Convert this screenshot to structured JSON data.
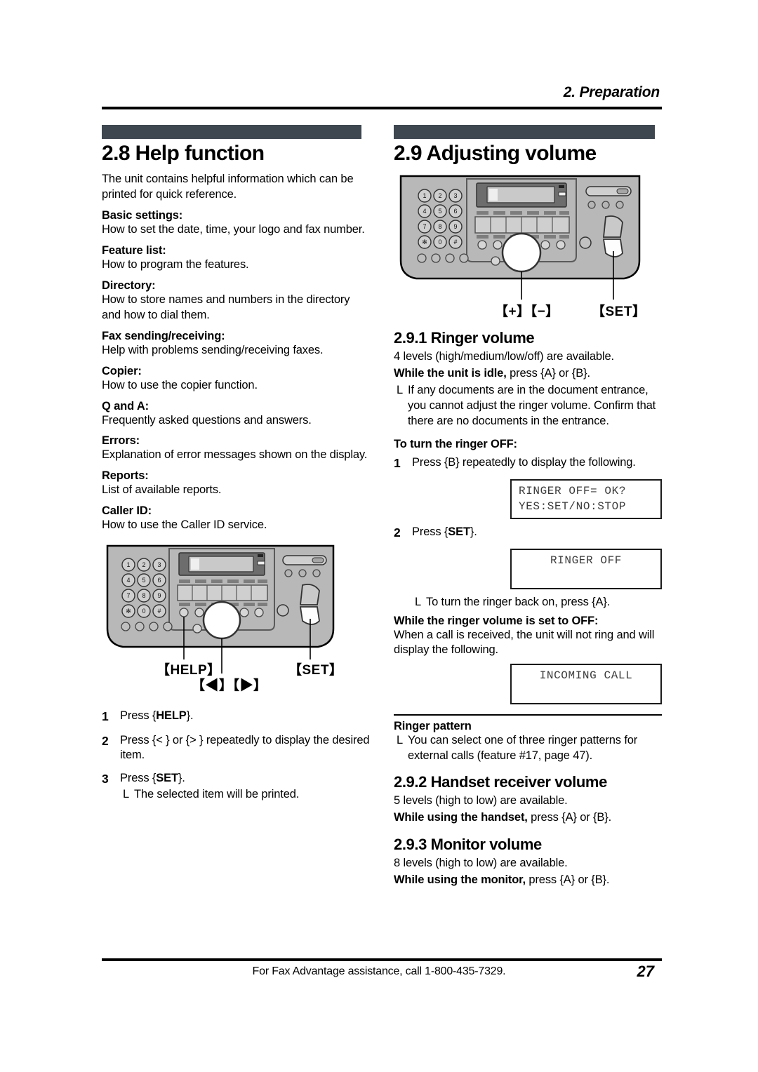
{
  "header": {
    "chapter": "2. Preparation"
  },
  "left_column": {
    "section_number_title": "2.8 Help function",
    "intro": "The unit contains helpful information which can be printed for quick reference.",
    "items": [
      {
        "term": "Basic settings:",
        "def": "How to set the date, time, your logo and fax number."
      },
      {
        "term": "Feature list:",
        "def": "How to program the features."
      },
      {
        "term": "Directory:",
        "def": "How to store names and numbers in the directory and how to dial them."
      },
      {
        "term": "Fax sending/receiving:",
        "def": "Help with problems sending/receiving faxes."
      },
      {
        "term": "Copier:",
        "def": "How to use the copier function."
      },
      {
        "term": "Q and A:",
        "def": "Frequently asked questions and answers."
      },
      {
        "term": "Errors:",
        "def": "Explanation of error messages shown on the display."
      },
      {
        "term": "Reports:",
        "def": "List of available reports."
      },
      {
        "term": "Caller ID:",
        "def": "How to use the Caller ID service."
      }
    ],
    "diagram": {
      "label_help": "【HELP】",
      "label_set": "【SET】",
      "label_arrows": "【◀】【▶】",
      "keypad": [
        "1",
        "2",
        "3",
        "4",
        "5",
        "6",
        "7",
        "8",
        "9",
        "✱",
        "0",
        "#"
      ]
    },
    "steps": [
      {
        "num": "1",
        "text": "Press {HELP}.",
        "bold_token": "HELP"
      },
      {
        "num": "2",
        "text": "Press {< } or {> } repeatedly to display the desired item."
      },
      {
        "num": "3",
        "text": "Press {SET}.",
        "bold_token": "SET",
        "sub": "The selected item will be printed."
      }
    ]
  },
  "right_column": {
    "section_number_title": "2.9 Adjusting volume",
    "diagram": {
      "label_plusminus": "【+】【−】",
      "label_set": "【SET】",
      "keypad": [
        "1",
        "2",
        "3",
        "4",
        "5",
        "6",
        "7",
        "8",
        "9",
        "✱",
        "0",
        "#"
      ]
    },
    "ringer_volume": {
      "title": "2.9.1 Ringer volume",
      "levels": "4 levels (high/medium/low/off) are available.",
      "idle_bold": "While the unit is idle,",
      "idle_rest": " press {A} or {B}.",
      "note": "If any documents are in the document entrance, you cannot adjust the ringer volume. Confirm that there are no documents in the entrance.",
      "turn_off_heading": "To turn the ringer OFF:",
      "step1_num": "1",
      "step1_text": "Press {B} repeatedly to display the following.",
      "lcd1_line1": "RINGER OFF= OK?",
      "lcd1_line2": "YES:SET/NO:STOP",
      "step2_num": "2",
      "step2_text_pre": "Press {",
      "step2_bold": "SET",
      "step2_text_post": "}.",
      "lcd2_line1": "RINGER OFF",
      "back_on_note": "To turn the ringer back on, press {A}.",
      "set_off_heading": "While the ringer volume is set to OFF:",
      "set_off_body": "When a call is received, the unit will not ring and will display the following.",
      "lcd3_line1": "INCOMING CALL",
      "pattern_heading": "Ringer pattern",
      "pattern_note": "You can select one of three ringer patterns for external calls (feature #17, page 47)."
    },
    "handset_volume": {
      "title": "2.9.2 Handset receiver volume",
      "levels": "5 levels (high to low) are available.",
      "bold": "While using the handset,",
      "rest": " press {A} or {B}."
    },
    "monitor_volume": {
      "title": "2.9.3 Monitor volume",
      "levels": "8 levels (high to low) are available.",
      "bold": "While using the monitor,",
      "rest": " press {A} or {B}."
    }
  },
  "footer": {
    "assistance": "For Fax Advantage assistance, call 1-800-435-7329.",
    "page_number": "27"
  },
  "colors": {
    "section_bar": "#3e4750",
    "rule": "#000000",
    "device_body": "#b5b5b5",
    "device_dark": "#6d6d6d"
  }
}
